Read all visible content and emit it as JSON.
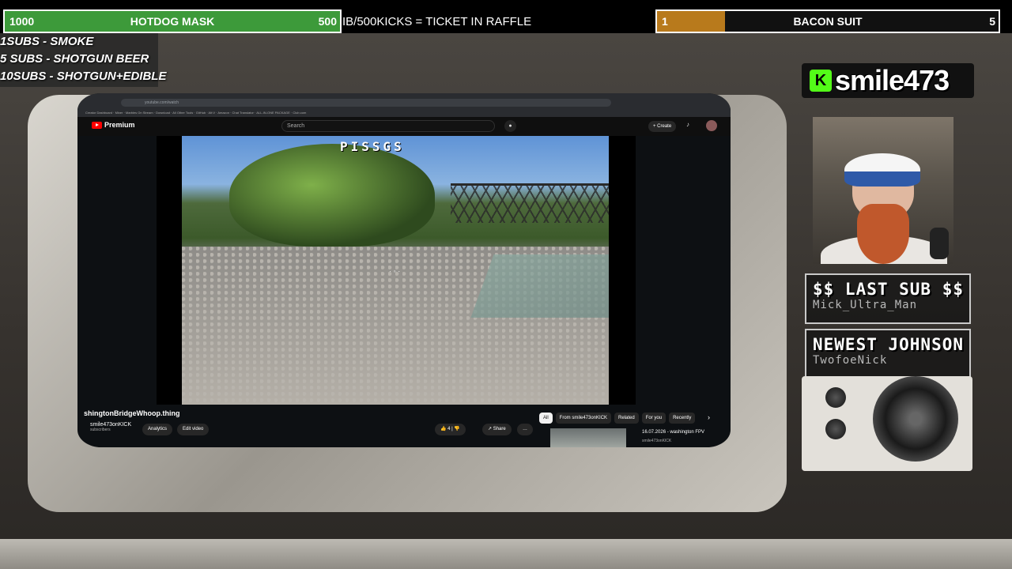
{
  "goals": {
    "left": {
      "start": "1000",
      "title": "HOTDOG MASK",
      "end": "500",
      "progress": 1.0
    },
    "right": {
      "start": "1",
      "title": "BACON SUIT",
      "end": "5",
      "progress": 0.2
    }
  },
  "raffle_text": "IB/500KICKS = TICKET IN RAFFLE",
  "tiers": [
    "1SUBS   - SMOKE",
    "5 SUBS  - SHOTGUN BEER",
    "10SUBS - SHOTGUN+EDIBLE"
  ],
  "kick": {
    "badge": "K",
    "name": "smile473"
  },
  "last_sub": {
    "heading": "$$ LAST SUB $$",
    "name": "Mick_Ultra_Man"
  },
  "newest": {
    "heading": "NEWEST JOHNSON",
    "name": "TwofoeNick"
  },
  "youtube": {
    "logo": "Premium",
    "search_placeholder": "Search",
    "create_label": "Create",
    "osd_text": "PISSGS",
    "video_title": "shingtonBridgeWhoop.thing",
    "channel": "smile473onKICK",
    "subscribers": "subscribers",
    "analytics_label": "Analytics",
    "edit_video_label": "Edit video",
    "like_count": "4",
    "share_label": "Share",
    "chips": [
      "All",
      "From smile473onKICK",
      "Related",
      "For you",
      "Recently"
    ],
    "rec_title": "16.07.2026 - washington FPV",
    "rec_channel": "smile473onKICK"
  },
  "colors": {
    "goal_left_fill": "#3d9a3a",
    "goal_right_fill": "#b87a1c",
    "kick_green": "#53fc18",
    "youtube_red": "#ff0000"
  }
}
